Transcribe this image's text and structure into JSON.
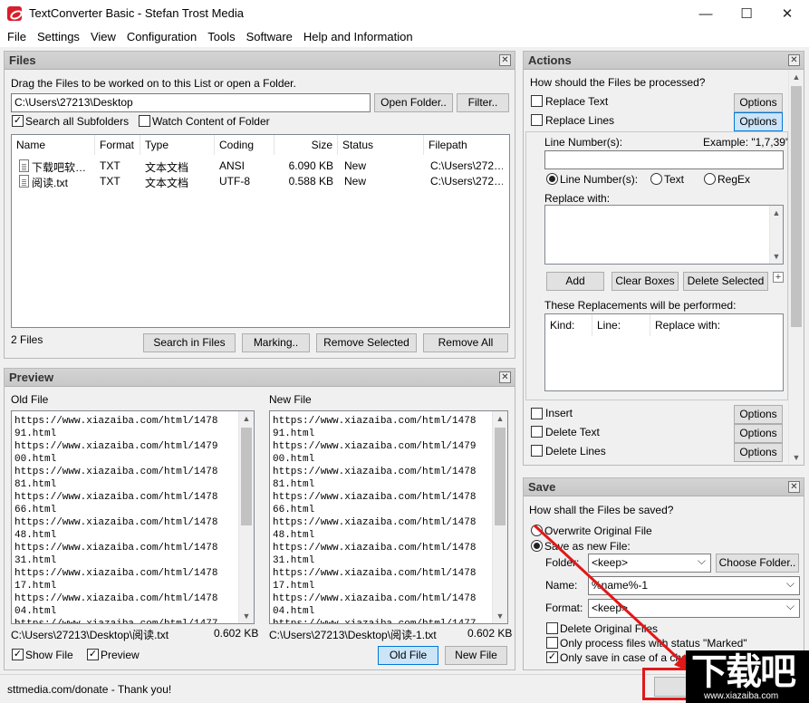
{
  "window": {
    "title": "TextConverter Basic - Stefan Trost Media",
    "minimize": "—",
    "maximize": "☐",
    "close": "✕"
  },
  "menu": [
    "File",
    "Settings",
    "View",
    "Configuration",
    "Tools",
    "Software",
    "Help and Information"
  ],
  "files_panel": {
    "title": "Files",
    "hint": "Drag the Files to be worked on to this List or open a Folder.",
    "path": "C:\\Users\\27213\\Desktop",
    "open_folder": "Open Folder..",
    "filter": "Filter..",
    "search_subfolders": "Search all Subfolders",
    "watch_folder": "Watch Content of Folder",
    "columns": [
      "Name",
      "Format",
      "Type",
      "Coding",
      "Size",
      "Status",
      "Filepath"
    ],
    "rows": [
      {
        "name": "下载吧软…",
        "format": "TXT",
        "type": "文本文档",
        "coding": "ANSI",
        "size": "6.090 KB",
        "status": "New",
        "path": "C:\\Users\\272…"
      },
      {
        "name": "阅读.txt",
        "format": "TXT",
        "type": "文本文档",
        "coding": "UTF-8",
        "size": "0.588 KB",
        "status": "New",
        "path": "C:\\Users\\272…"
      }
    ],
    "count": "2 Files",
    "search_in_files": "Search in Files",
    "marking": "Marking..",
    "remove_selected": "Remove Selected",
    "remove_all": "Remove All"
  },
  "preview_panel": {
    "title": "Preview",
    "old_label": "Old File",
    "new_label": "New File",
    "old_text": "https://www.xiazaiba.com/html/1478\n91.html\nhttps://www.xiazaiba.com/html/1479\n00.html\nhttps://www.xiazaiba.com/html/1478\n81.html\nhttps://www.xiazaiba.com/html/1478\n66.html\nhttps://www.xiazaiba.com/html/1478\n48.html\nhttps://www.xiazaiba.com/html/1478\n31.html\nhttps://www.xiazaiba.com/html/1478\n17.html\nhttps://www.xiazaiba.com/html/1478\n04.html\nhttps://www.xiazaiba.com/html/1477",
    "new_text": "https://www.xiazaiba.com/html/1478\n91.html\nhttps://www.xiazaiba.com/html/1479\n00.html\nhttps://www.xiazaiba.com/html/1478\n81.html\nhttps://www.xiazaiba.com/html/1478\n66.html\nhttps://www.xiazaiba.com/html/1478\n48.html\nhttps://www.xiazaiba.com/html/1478\n31.html\nhttps://www.xiazaiba.com/html/1478\n17.html\nhttps://www.xiazaiba.com/html/1478\n04.html\nhttps://www.xiazaiba.com/html/1477",
    "old_path": "C:\\Users\\27213\\Desktop\\阅读.txt",
    "old_size": "0.602 KB",
    "new_path": "C:\\Users\\27213\\Desktop\\阅读-1.txt",
    "new_size": "0.602 KB",
    "show_file": "Show File",
    "preview": "Preview",
    "old_file_btn": "Old File",
    "new_file_btn": "New File"
  },
  "actions_panel": {
    "title": "Actions",
    "question": "How should the Files be processed?",
    "replace_text": "Replace Text",
    "replace_lines": "Replace Lines",
    "options": "Options",
    "line_numbers_label": "Line Number(s):",
    "example": "Example: \"1,7,39\"",
    "line_numbers_value": "",
    "mode_line": "Line Number(s):",
    "mode_text": "Text",
    "mode_regex": "RegEx",
    "replace_with": "Replace with:",
    "add": "Add",
    "clear_boxes": "Clear Boxes",
    "delete_selected": "Delete Selected",
    "plus": "+",
    "replacements_label": "These Replacements will be performed:",
    "rep_columns": [
      "Kind:",
      "Line:",
      "Replace with:"
    ],
    "insert": "Insert",
    "delete_text": "Delete Text",
    "delete_lines": "Delete Lines"
  },
  "save_panel": {
    "title": "Save",
    "question": "How shall the Files be saved?",
    "overwrite": "Overwrite Original File",
    "save_new": "Save as new File:",
    "folder_label": "Folder:",
    "folder_value": "<keep>",
    "choose_folder": "Choose Folder..",
    "name_label": "Name:",
    "name_value": "%name%-1",
    "format_label": "Format:",
    "format_value": "<keep>",
    "delete_original": "Delete Original Files",
    "only_marked": "Only process files with status \"Marked\"",
    "only_changed": "Only save in case of a change"
  },
  "status": {
    "text": "sttmedia.com/donate - Thank you!"
  },
  "watermark": {
    "logo": "下载吧",
    "url": "www.xiazaiba.com"
  },
  "colors": {
    "accent": "#0078d7",
    "annotation": "#e01818"
  }
}
